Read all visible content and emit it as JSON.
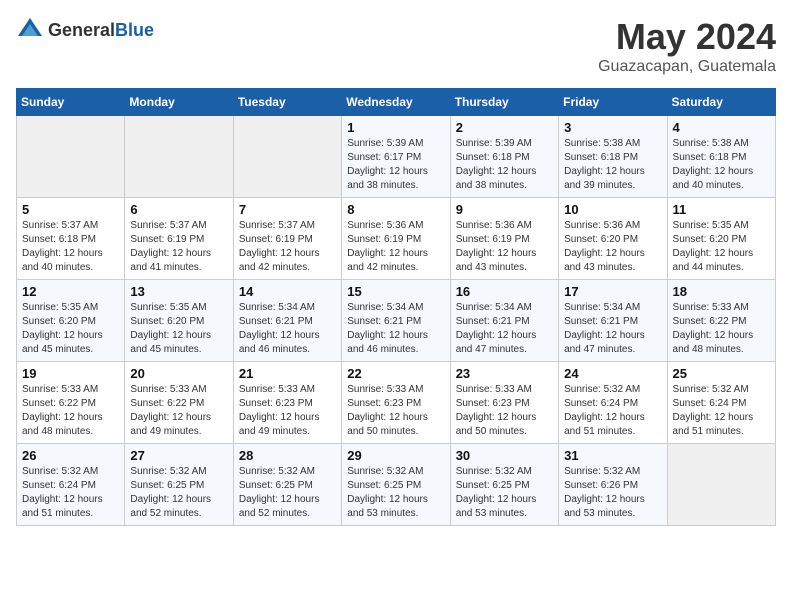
{
  "header": {
    "logo_general": "General",
    "logo_blue": "Blue",
    "title": "May 2024",
    "location": "Guazacapan, Guatemala"
  },
  "weekdays": [
    "Sunday",
    "Monday",
    "Tuesday",
    "Wednesday",
    "Thursday",
    "Friday",
    "Saturday"
  ],
  "weeks": [
    [
      {
        "day": "",
        "info": ""
      },
      {
        "day": "",
        "info": ""
      },
      {
        "day": "",
        "info": ""
      },
      {
        "day": "1",
        "info": "Sunrise: 5:39 AM\nSunset: 6:17 PM\nDaylight: 12 hours\nand 38 minutes."
      },
      {
        "day": "2",
        "info": "Sunrise: 5:39 AM\nSunset: 6:18 PM\nDaylight: 12 hours\nand 38 minutes."
      },
      {
        "day": "3",
        "info": "Sunrise: 5:38 AM\nSunset: 6:18 PM\nDaylight: 12 hours\nand 39 minutes."
      },
      {
        "day": "4",
        "info": "Sunrise: 5:38 AM\nSunset: 6:18 PM\nDaylight: 12 hours\nand 40 minutes."
      }
    ],
    [
      {
        "day": "5",
        "info": "Sunrise: 5:37 AM\nSunset: 6:18 PM\nDaylight: 12 hours\nand 40 minutes."
      },
      {
        "day": "6",
        "info": "Sunrise: 5:37 AM\nSunset: 6:19 PM\nDaylight: 12 hours\nand 41 minutes."
      },
      {
        "day": "7",
        "info": "Sunrise: 5:37 AM\nSunset: 6:19 PM\nDaylight: 12 hours\nand 42 minutes."
      },
      {
        "day": "8",
        "info": "Sunrise: 5:36 AM\nSunset: 6:19 PM\nDaylight: 12 hours\nand 42 minutes."
      },
      {
        "day": "9",
        "info": "Sunrise: 5:36 AM\nSunset: 6:19 PM\nDaylight: 12 hours\nand 43 minutes."
      },
      {
        "day": "10",
        "info": "Sunrise: 5:36 AM\nSunset: 6:20 PM\nDaylight: 12 hours\nand 43 minutes."
      },
      {
        "day": "11",
        "info": "Sunrise: 5:35 AM\nSunset: 6:20 PM\nDaylight: 12 hours\nand 44 minutes."
      }
    ],
    [
      {
        "day": "12",
        "info": "Sunrise: 5:35 AM\nSunset: 6:20 PM\nDaylight: 12 hours\nand 45 minutes."
      },
      {
        "day": "13",
        "info": "Sunrise: 5:35 AM\nSunset: 6:20 PM\nDaylight: 12 hours\nand 45 minutes."
      },
      {
        "day": "14",
        "info": "Sunrise: 5:34 AM\nSunset: 6:21 PM\nDaylight: 12 hours\nand 46 minutes."
      },
      {
        "day": "15",
        "info": "Sunrise: 5:34 AM\nSunset: 6:21 PM\nDaylight: 12 hours\nand 46 minutes."
      },
      {
        "day": "16",
        "info": "Sunrise: 5:34 AM\nSunset: 6:21 PM\nDaylight: 12 hours\nand 47 minutes."
      },
      {
        "day": "17",
        "info": "Sunrise: 5:34 AM\nSunset: 6:21 PM\nDaylight: 12 hours\nand 47 minutes."
      },
      {
        "day": "18",
        "info": "Sunrise: 5:33 AM\nSunset: 6:22 PM\nDaylight: 12 hours\nand 48 minutes."
      }
    ],
    [
      {
        "day": "19",
        "info": "Sunrise: 5:33 AM\nSunset: 6:22 PM\nDaylight: 12 hours\nand 48 minutes."
      },
      {
        "day": "20",
        "info": "Sunrise: 5:33 AM\nSunset: 6:22 PM\nDaylight: 12 hours\nand 49 minutes."
      },
      {
        "day": "21",
        "info": "Sunrise: 5:33 AM\nSunset: 6:23 PM\nDaylight: 12 hours\nand 49 minutes."
      },
      {
        "day": "22",
        "info": "Sunrise: 5:33 AM\nSunset: 6:23 PM\nDaylight: 12 hours\nand 50 minutes."
      },
      {
        "day": "23",
        "info": "Sunrise: 5:33 AM\nSunset: 6:23 PM\nDaylight: 12 hours\nand 50 minutes."
      },
      {
        "day": "24",
        "info": "Sunrise: 5:32 AM\nSunset: 6:24 PM\nDaylight: 12 hours\nand 51 minutes."
      },
      {
        "day": "25",
        "info": "Sunrise: 5:32 AM\nSunset: 6:24 PM\nDaylight: 12 hours\nand 51 minutes."
      }
    ],
    [
      {
        "day": "26",
        "info": "Sunrise: 5:32 AM\nSunset: 6:24 PM\nDaylight: 12 hours\nand 51 minutes."
      },
      {
        "day": "27",
        "info": "Sunrise: 5:32 AM\nSunset: 6:25 PM\nDaylight: 12 hours\nand 52 minutes."
      },
      {
        "day": "28",
        "info": "Sunrise: 5:32 AM\nSunset: 6:25 PM\nDaylight: 12 hours\nand 52 minutes."
      },
      {
        "day": "29",
        "info": "Sunrise: 5:32 AM\nSunset: 6:25 PM\nDaylight: 12 hours\nand 53 minutes."
      },
      {
        "day": "30",
        "info": "Sunrise: 5:32 AM\nSunset: 6:25 PM\nDaylight: 12 hours\nand 53 minutes."
      },
      {
        "day": "31",
        "info": "Sunrise: 5:32 AM\nSunset: 6:26 PM\nDaylight: 12 hours\nand 53 minutes."
      },
      {
        "day": "",
        "info": ""
      }
    ]
  ]
}
